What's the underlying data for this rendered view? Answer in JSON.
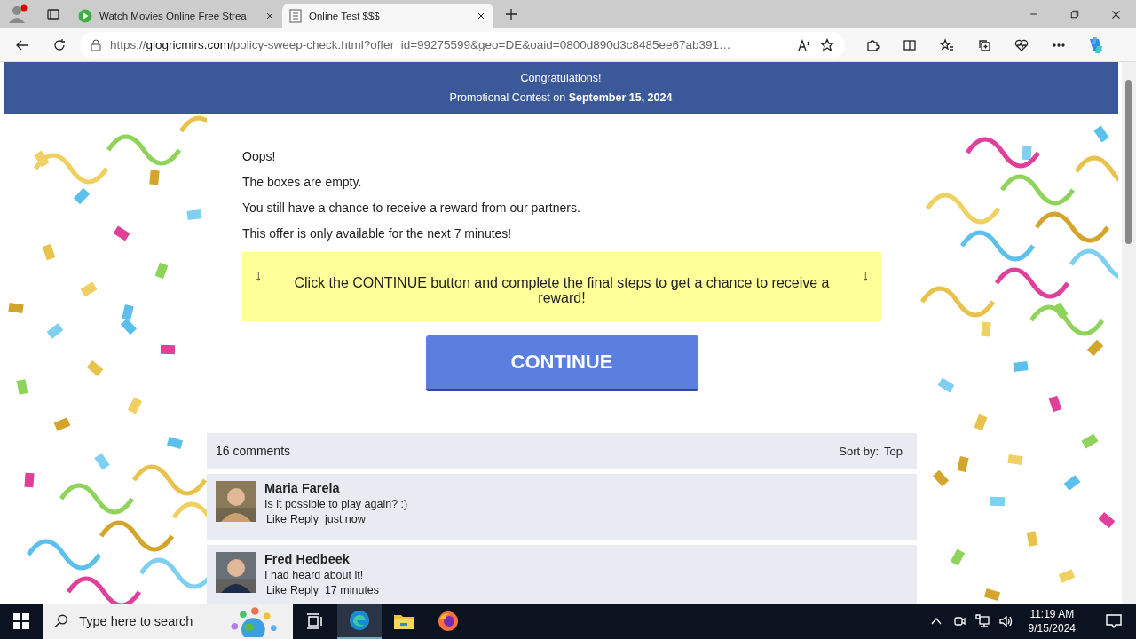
{
  "browser": {
    "tabs": [
      {
        "title": "Watch Movies Online Free Strea",
        "selected": false
      },
      {
        "title": "Online Test $$$",
        "selected": true
      }
    ],
    "address": {
      "scheme": "https://",
      "host": "glogricmirs.com",
      "path": "/policy-sweep-check.html?offer_id=99275599&geo=DE&oaid=0800d890d3c8485ee67ab391…"
    }
  },
  "header": {
    "title": "Congratulations!",
    "subtitle": "Promotional Contest on **September 15, 2024**"
  },
  "messages": [
    "Oops!",
    "The boxes are empty.",
    "You still have a chance to receive a reward from our partners.",
    "This offer is only available for the next 7 minutes!"
  ],
  "notice": {
    "left_arrow": "↓",
    "text": "Click the CONTINUE button and complete the final steps to get a chance to receive a reward!",
    "right_arrow": "↓"
  },
  "continue_button": "CONTINUE",
  "comments": {
    "count": "16 comments",
    "sort_label": "Sort by:",
    "sort_value": "Top",
    "items": [
      {
        "name": "Maria Farela",
        "text": "Is it possible to play again? :)",
        "like": "Like",
        "reply": "Reply",
        "time": "just now"
      },
      {
        "name": "Fred Hedbeek",
        "text": "I had heard about it!",
        "like": "Like",
        "reply": "Reply",
        "time": "17 minutes"
      }
    ]
  },
  "taskbar": {
    "search_placeholder": "Type here to search",
    "time": "11:19 AM",
    "date": "9/15/2024"
  }
}
